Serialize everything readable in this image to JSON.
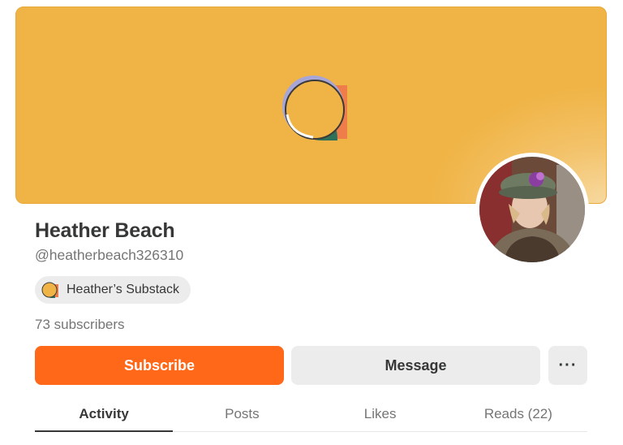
{
  "profile": {
    "name": "Heather Beach",
    "handle": "@heatherbeach326310",
    "subscribers": "73 subscribers",
    "banner_color": "#f0b446",
    "avatar_icon": "user-photo"
  },
  "publication": {
    "name": "Heather’s Substack",
    "icon": "substack-logo-icon"
  },
  "actions": {
    "subscribe_label": "Subscribe",
    "message_label": "Message",
    "more_label": "···",
    "accent_color": "#ff6719"
  },
  "tabs": [
    {
      "label": "Activity",
      "active": true
    },
    {
      "label": "Posts",
      "active": false
    },
    {
      "label": "Likes",
      "active": false
    },
    {
      "label": "Reads (22)",
      "active": false
    }
  ]
}
